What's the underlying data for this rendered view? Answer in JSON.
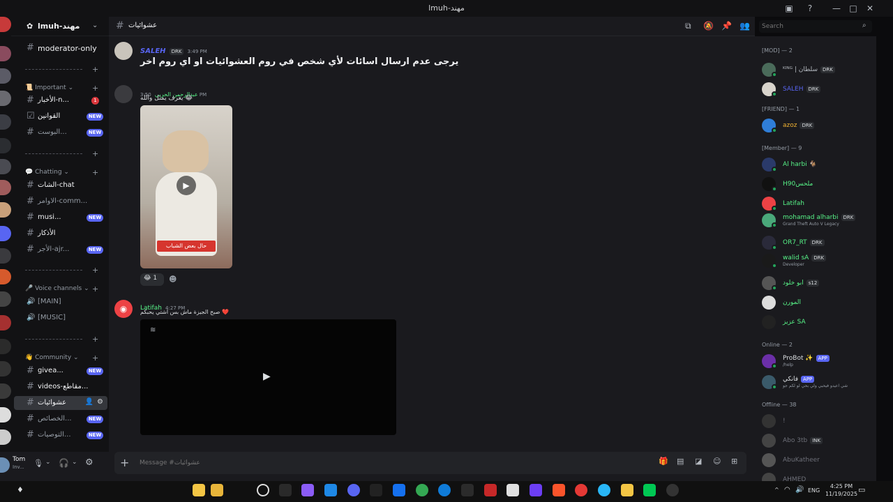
{
  "window": {
    "title": "lmuh-مهند"
  },
  "server": {
    "name": "lmuh-مهند"
  },
  "channels": {
    "moderator": "moderator-only",
    "cat_important": "Important",
    "news": "الأخبار-n...",
    "news_badge": "1",
    "rules": "القوانين",
    "boost": "البوست...",
    "cat_chatting": "Chatting",
    "chat": "الشات-chat",
    "commands": "الاوامر-comm...",
    "music": "musi...",
    "athkar": "الأذكار",
    "ajr": "الأجر-ajr...",
    "cat_voice": "Voice channels",
    "voice_main": "[MAIN]",
    "voice_music": "[MUSIC]",
    "cat_community": "Community",
    "giveaway": "givea...",
    "videos": "videos-مقاطع...",
    "random": "عشوائيات",
    "ch_q1": "الخصائص...",
    "ch_q2": "التوصيات...",
    "new_label": "NEW"
  },
  "user": {
    "name": "Tom",
    "status": "Inv..."
  },
  "chat": {
    "channel_name": "عشوائيات",
    "messages": [
      {
        "author": "SALEH",
        "tag": "DRK",
        "time": "3:49 PM",
        "text": "يرجى عدم ارسال اسائات لأي شخص في روم العشوائيات او اي روم اخر"
      },
      {
        "author": "عبدالرحمن الحربي",
        "time": "3:50 PM",
        "text": "يعرف يمثل والله 😂",
        "video_caption": "حال بعض الشباب",
        "reaction_count": "1"
      },
      {
        "author": "Latifah",
        "time": "4:27 PM",
        "text": "صبح الجيزة ماش بس اشتي يحبكم ❤️"
      }
    ],
    "composer_placeholder": "Message #عشوائيات"
  },
  "search": {
    "placeholder": "Search"
  },
  "members": {
    "mod_header": "[MOD] — 2",
    "friend_header": "[FRIEND] — 1",
    "member_header": "[Member] — 9",
    "online_header": "Online — 2",
    "offline_header": "Offline — 38",
    "list": [
      {
        "name": "ᴷᴵᴺᴳ | سلطان",
        "tag": "DRK",
        "color": "#b5bac1"
      },
      {
        "name": "SALEH",
        "tag": "DRK",
        "color": "#5865f2"
      },
      {
        "name": "azoz",
        "tag": "DRK",
        "color": "#f0b232"
      },
      {
        "name": "Al harbi 🐐",
        "color": "#57f287"
      },
      {
        "name": "H90ملحس",
        "color": "#57f287"
      },
      {
        "name": "Latifah",
        "color": "#57f287"
      },
      {
        "name": "mohamad alharbi",
        "tag": "DRK",
        "status": "Grand Theft Auto V Legacy",
        "color": "#57f287"
      },
      {
        "name": "OR7_RT",
        "tag": "DRK",
        "color": "#57f287"
      },
      {
        "name": "walid sA",
        "tag": "DRK",
        "status": "Developer",
        "color": "#57f287"
      },
      {
        "name": "ابو خلود",
        "tag": "s12",
        "color": "#57f287"
      },
      {
        "name": "المورن",
        "color": "#57f287"
      },
      {
        "name": "عزيز SA",
        "color": "#57f287"
      },
      {
        "name": "ProBot ✨",
        "tag": "APP",
        "status": "/help",
        "color": "#dbdee1"
      },
      {
        "name": "فانكي",
        "tag": "APP",
        "status": "شي اعيدو فيحبي ولي بحي لو لكم جو",
        "color": "#dbdee1"
      },
      {
        "name": "!",
        "color": "#6d6f78"
      },
      {
        "name": "Abo 3tb",
        "tag": "INK",
        "color": "#6d6f78"
      },
      {
        "name": "AbuKatheer",
        "color": "#6d6f78"
      },
      {
        "name": "AHMED",
        "color": "#6d6f78"
      }
    ]
  },
  "taskbar": {
    "time": "4:25 PM",
    "date": "11/19/2025",
    "lang": "ENG"
  },
  "colors": {
    "accent": "#5865f2",
    "online": "#23a55a",
    "bg": "#1a1a1e"
  }
}
